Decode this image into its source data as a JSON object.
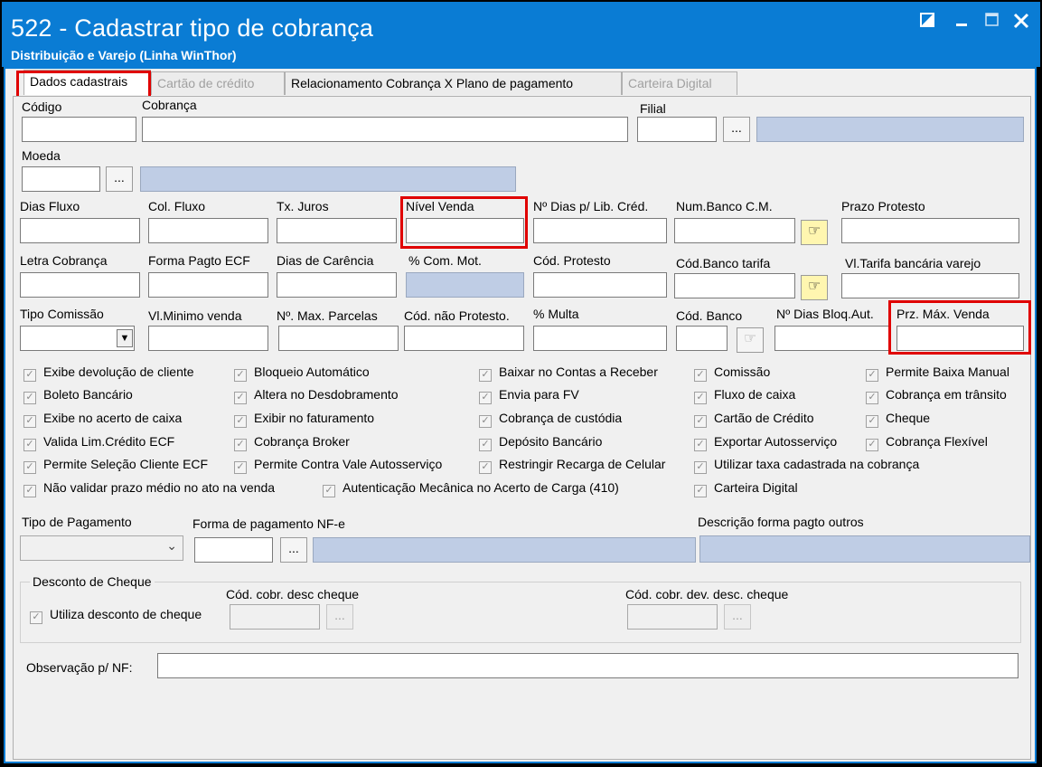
{
  "window": {
    "title": "522 - Cadastrar tipo de cobrança",
    "subtitle": "Distribuição e Varejo (Linha WinThor)",
    "controls": {
      "restore": "◪",
      "minimize": "_",
      "maximize": "☐",
      "close": "✕"
    }
  },
  "tabs": [
    {
      "label": "Dados cadastrais",
      "state": "active"
    },
    {
      "label": "Cartão de crédito",
      "state": "disabled"
    },
    {
      "label": "Relacionamento Cobrança X Plano de pagamento",
      "state": "enabled"
    },
    {
      "label": "Carteira Digital",
      "state": "disabled"
    }
  ],
  "fields": {
    "codigo": {
      "label": "Código",
      "value": ""
    },
    "cobranca": {
      "label": "Cobrança",
      "value": ""
    },
    "filial": {
      "label": "Filial",
      "value": "",
      "button": "..."
    },
    "moeda": {
      "label": "Moeda",
      "value": "",
      "button": "..."
    },
    "dias_fluxo": {
      "label": "Dias Fluxo",
      "value": ""
    },
    "col_fluxo": {
      "label": "Col. Fluxo",
      "value": ""
    },
    "tx_juros": {
      "label": "Tx. Juros",
      "value": ""
    },
    "nivel_venda": {
      "label": "Nível Venda",
      "value": ""
    },
    "n_dias_lib_cred": {
      "label": "Nº Dias p/ Lib. Créd.",
      "value": ""
    },
    "num_banco_cm": {
      "label": "Num.Banco C.M.",
      "value": ""
    },
    "prazo_protesto": {
      "label": "Prazo Protesto",
      "value": ""
    },
    "letra_cobranca": {
      "label": "Letra Cobrança",
      "value": ""
    },
    "forma_pagto_ecf": {
      "label": "Forma Pagto ECF",
      "value": ""
    },
    "dias_carencia": {
      "label": "Dias de Carência",
      "value": ""
    },
    "com_mot": {
      "label": "% Com. Mot.",
      "value": ""
    },
    "cod_protesto": {
      "label": "Cód. Protesto",
      "value": ""
    },
    "cod_banco_tarifa": {
      "label": "Cód.Banco tarifa",
      "value": ""
    },
    "vl_tarifa_bancaria": {
      "label": "Vl.Tarifa bancária varejo",
      "value": ""
    },
    "tipo_comissao": {
      "label": "Tipo Comissão",
      "value": ""
    },
    "vl_minimo_venda": {
      "label": "Vl.Minimo venda",
      "value": ""
    },
    "max_parcelas": {
      "label": "Nº. Max. Parcelas",
      "value": ""
    },
    "cod_nao_protesto": {
      "label": "Cód. não Protesto.",
      "value": ""
    },
    "multa": {
      "label": "% Multa",
      "value": ""
    },
    "cod_banco": {
      "label": "Cód. Banco",
      "value": ""
    },
    "dias_bloq_aut": {
      "label": "Nº Dias Bloq.Aut.",
      "value": ""
    },
    "prz_max_venda": {
      "label": "Prz. Máx. Venda",
      "value": ""
    }
  },
  "checkboxes": [
    {
      "label": "Exibe devolução de cliente"
    },
    {
      "label": "Boleto Bancário"
    },
    {
      "label": "Exibe no acerto de caixa"
    },
    {
      "label": "Valida Lim.Crédito ECF"
    },
    {
      "label": "Permite Seleção Cliente ECF"
    },
    {
      "label": "Não validar prazo médio no ato na venda"
    },
    {
      "label": "Bloqueio Automático"
    },
    {
      "label": "Altera no Desdobramento"
    },
    {
      "label": "Exibir no faturamento"
    },
    {
      "label": "Cobrança Broker"
    },
    {
      "label": "Permite Contra Vale Autosserviço"
    },
    {
      "label": "Autenticação Mecânica no Acerto de Carga (410)"
    },
    {
      "label": "Baixar no Contas a Receber"
    },
    {
      "label": "Envia para FV"
    },
    {
      "label": "Cobrança de custódia"
    },
    {
      "label": "Depósito Bancário"
    },
    {
      "label": "Restringir Recarga de Celular"
    },
    {
      "label": "Comissão"
    },
    {
      "label": "Fluxo de caixa"
    },
    {
      "label": "Cartão de Crédito"
    },
    {
      "label": "Exportar Autosserviço"
    },
    {
      "label": "Utilizar taxa cadastrada na cobrança"
    },
    {
      "label": "Carteira Digital"
    },
    {
      "label": "Permite Baixa Manual"
    },
    {
      "label": "Cobrança em trânsito"
    },
    {
      "label": "Cheque"
    },
    {
      "label": "Cobrança Flexível"
    }
  ],
  "payment": {
    "tipo_pagamento_label": "Tipo de Pagamento",
    "tipo_pagamento_value": "",
    "forma_pagamento_nfe_label": "Forma de pagamento NF-e",
    "forma_pagamento_nfe_value": "",
    "descricao_outros_label": "Descrição forma pagto outros",
    "button": "..."
  },
  "desconto_cheque": {
    "legend": "Desconto de Cheque",
    "utiliza_label": "Utiliza desconto de cheque",
    "cod_desc_label": "Cód. cobr. desc cheque",
    "cod_dev_label": "Cód. cobr. dev. desc. cheque",
    "button": "..."
  },
  "observacao": {
    "label": "Observação p/ NF:",
    "value": ""
  },
  "icons": {
    "check": "✓",
    "hand": "☞",
    "dropdown": "▼",
    "chevron": "⌄"
  }
}
